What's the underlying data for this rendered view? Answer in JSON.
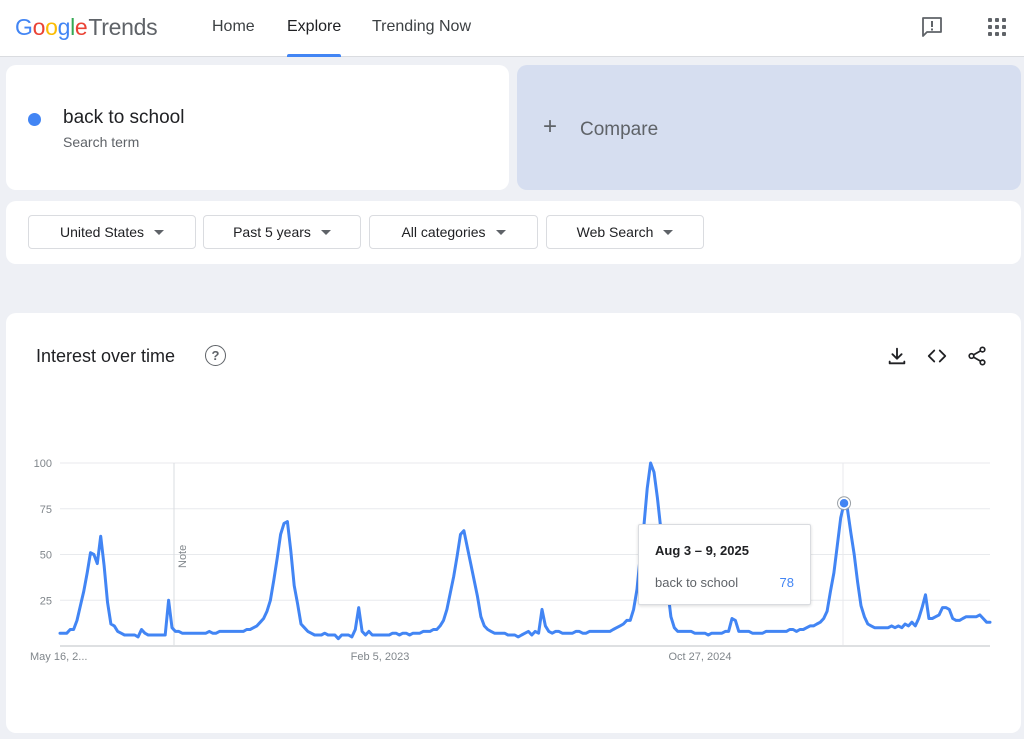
{
  "app": {
    "logo_google": "Google",
    "logo_trends": "Trends",
    "nav": [
      "Home",
      "Explore",
      "Trending Now"
    ],
    "active_tab": "Explore"
  },
  "search": {
    "term": "back to school",
    "term_type": "Search term",
    "term_color": "#4285f4",
    "compare_label": "Compare"
  },
  "filters": {
    "region": "United States",
    "period": "Past 5 years",
    "category": "All categories",
    "source": "Web Search"
  },
  "chart_card": {
    "title": "Interest over time",
    "note_label": "Note"
  },
  "tooltip": {
    "date": "Aug 3 – 9, 2025",
    "term": "back to school",
    "value": "78"
  },
  "chart_data": {
    "type": "line",
    "title": "Interest over time",
    "xlabel": "",
    "ylabel": "",
    "ylim": [
      0,
      100
    ],
    "yticks": [
      25,
      50,
      75,
      100
    ],
    "x_tick_labels": [
      "May 16, 2...",
      "Feb 5, 2023",
      "Oct 27, 2024"
    ],
    "grid": true,
    "legend": "none",
    "color": "#4285f4",
    "series": [
      {
        "values": [
          7,
          7,
          7,
          9,
          9,
          14,
          22,
          30,
          40,
          51,
          50,
          45,
          60,
          44,
          24,
          12,
          11,
          8,
          7,
          6,
          6,
          6,
          6,
          5,
          9,
          7,
          6,
          6,
          6,
          6,
          6,
          6,
          25,
          10,
          8,
          8,
          7,
          7,
          7,
          7,
          7,
          7,
          7,
          7,
          8,
          7,
          7,
          8,
          8,
          8,
          8,
          8,
          8,
          8,
          8,
          9,
          9,
          10,
          11,
          13,
          15,
          19,
          25,
          36,
          48,
          61,
          67,
          68,
          52,
          33,
          23,
          12,
          10,
          8,
          7,
          6,
          6,
          6,
          7,
          6,
          6,
          6,
          4,
          6,
          6,
          6,
          5,
          9,
          21,
          8,
          6,
          8,
          6,
          6,
          6,
          6,
          6,
          6,
          7,
          7,
          6,
          7,
          7,
          6,
          7,
          7,
          7,
          8,
          8,
          8,
          9,
          9,
          11,
          14,
          20,
          29,
          38,
          49,
          61,
          63,
          54,
          45,
          36,
          27,
          16,
          11,
          9,
          8,
          7,
          7,
          7,
          7,
          6,
          6,
          6,
          5,
          6,
          7,
          8,
          6,
          8,
          7,
          20,
          11,
          8,
          7,
          8,
          8,
          7,
          7,
          7,
          7,
          8,
          8,
          7,
          7,
          8,
          8,
          8,
          8,
          8,
          8,
          8,
          9,
          10,
          11,
          12,
          14,
          14,
          20,
          31,
          50,
          65,
          86,
          100,
          95,
          81,
          64,
          50,
          31,
          16,
          10,
          8,
          8,
          8,
          8,
          8,
          7,
          7,
          7,
          7,
          6,
          7,
          7,
          7,
          7,
          8,
          8,
          15,
          14,
          8,
          8,
          8,
          8,
          7,
          7,
          7,
          7,
          8,
          8,
          8,
          8,
          8,
          8,
          8,
          9,
          9,
          8,
          9,
          9,
          10,
          11,
          11,
          12,
          13,
          15,
          19,
          30,
          40,
          55,
          70,
          78,
          75,
          62,
          50,
          35,
          22,
          16,
          12,
          11,
          10,
          10,
          10,
          10,
          10,
          11,
          10,
          11,
          10,
          12,
          11,
          13,
          11,
          15,
          21,
          28,
          15,
          15,
          16,
          17,
          21,
          21,
          20,
          15,
          14,
          14,
          15,
          16,
          16,
          16,
          16,
          17,
          15,
          13,
          13
        ]
      }
    ]
  }
}
